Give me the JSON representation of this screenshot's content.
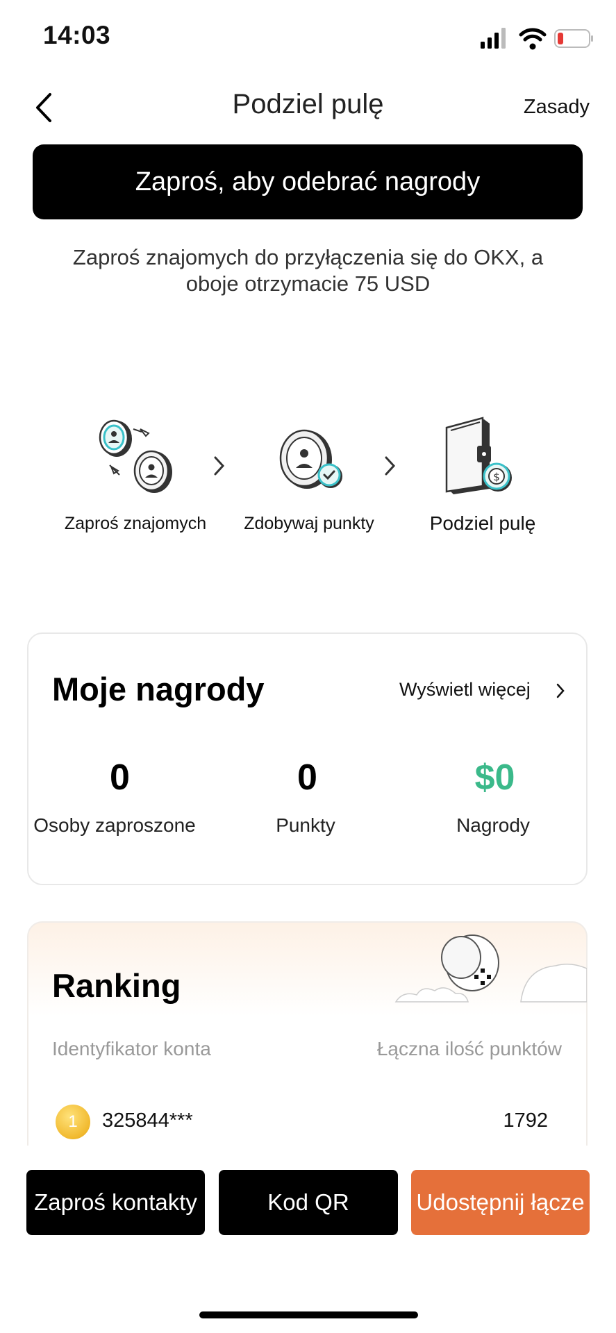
{
  "status_bar": {
    "time": "14:03"
  },
  "header": {
    "title": "Podziel pulę",
    "rules_label": "Zasady"
  },
  "banner": {
    "label": "Zaproś, aby odebrać nagrody"
  },
  "subtitle": {
    "line1": "Zaproś znajomych do przyłączenia się do OKX, a",
    "line2": "oboje otrzymacie 75 USD"
  },
  "steps": [
    {
      "label": "Zaproś znajomych",
      "icon": "invite-coins-icon"
    },
    {
      "label": "Zdobywaj punkty",
      "icon": "points-coin-icon"
    },
    {
      "label": "Podziel pulę",
      "icon": "wallet-coin-icon"
    }
  ],
  "rewards": {
    "title": "Moje nagrody",
    "view_more": "Wyświetl więcej",
    "stats": [
      {
        "value": "0",
        "label": "Osoby zaproszone"
      },
      {
        "value": "0",
        "label": "Punkty"
      },
      {
        "value": "$0",
        "label": "Nagrody"
      }
    ]
  },
  "ranking": {
    "title": "Ranking",
    "columns": [
      "Identyfikator konta",
      "Łączna ilość punktów"
    ],
    "rows": [
      {
        "rank": "1",
        "account": "325844***",
        "points": "1792"
      }
    ]
  },
  "actions": {
    "invite_contacts": "Zaproś kontakty",
    "qr_code": "Kod QR",
    "share_link": "Udostępnij łącze"
  },
  "colors": {
    "accent_green": "#3bb98a",
    "share_orange": "#e5703a",
    "primary_black": "#000000"
  }
}
